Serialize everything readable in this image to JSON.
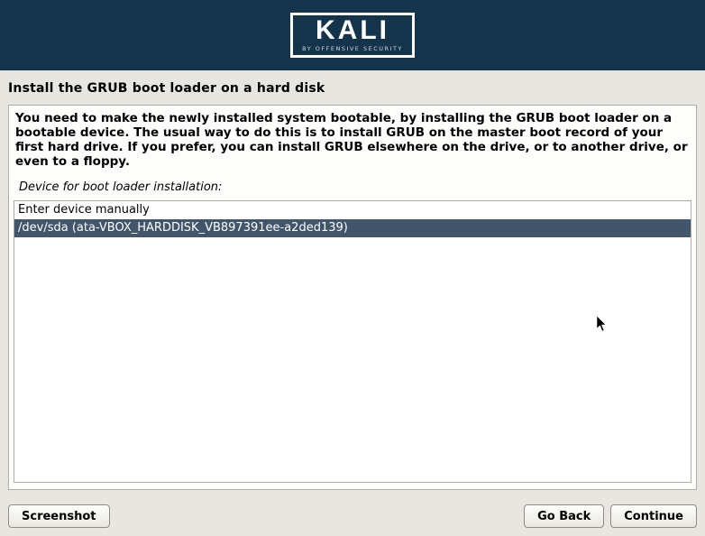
{
  "logo": {
    "main": "KALI",
    "sub": "BY OFFENSIVE SECURITY"
  },
  "page_title": "Install the GRUB boot loader on a hard disk",
  "instructions": "You need to make the newly installed system bootable, by installing the GRUB boot loader on a bootable device. The usual way to do this is to install GRUB on the master boot record of your first hard drive. If you prefer, you can install GRUB elsewhere on the drive, or to another drive, or even to a floppy.",
  "subhead": "Device for boot loader installation:",
  "options": [
    {
      "label": "Enter device manually",
      "selected": false
    },
    {
      "label": "/dev/sda  (ata-VBOX_HARDDISK_VB897391ee-a2ded139)",
      "selected": true
    }
  ],
  "buttons": {
    "screenshot": "Screenshot",
    "go_back": "Go Back",
    "continue": "Continue"
  }
}
